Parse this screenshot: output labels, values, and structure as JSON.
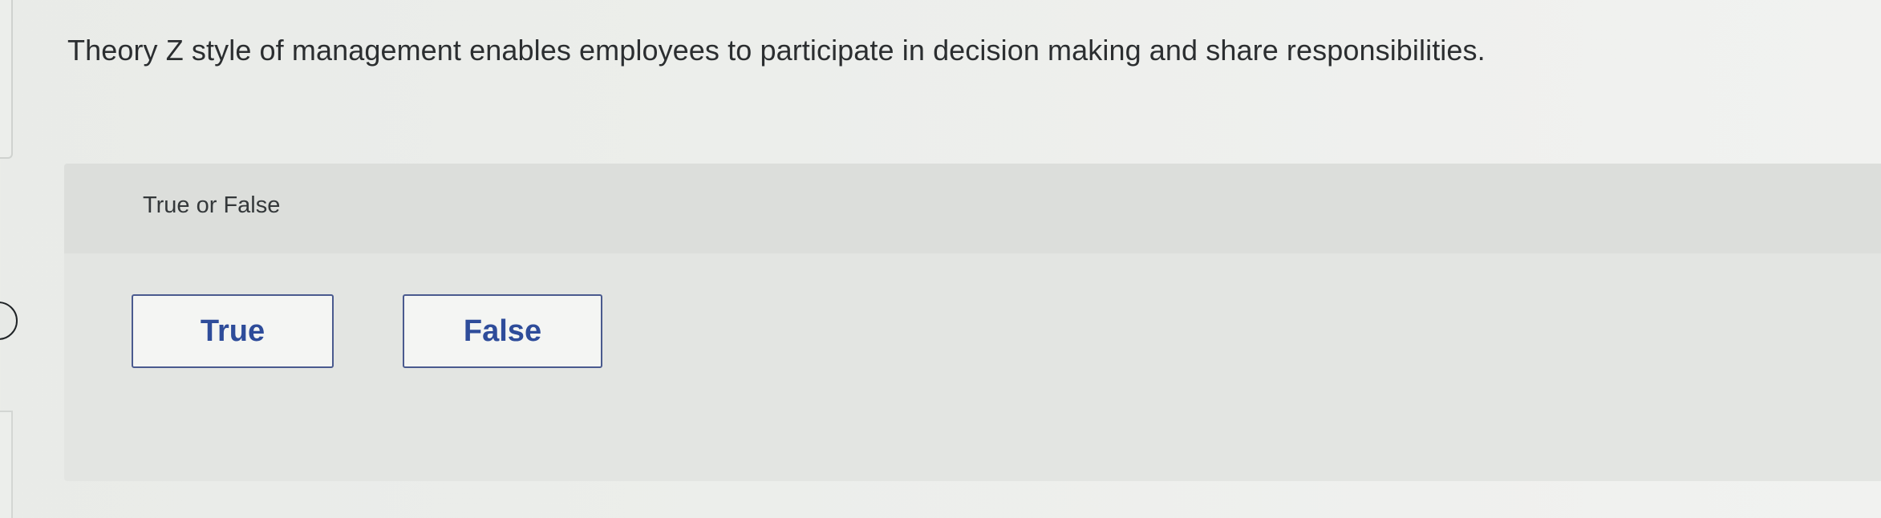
{
  "question": {
    "text": "Theory Z style of management enables employees to participate in decision making and share responsibilities."
  },
  "answer_area": {
    "prompt_label": "True or False",
    "choices": [
      {
        "label": "True"
      },
      {
        "label": "False"
      }
    ]
  },
  "colors": {
    "choice_text": "#2e4c9a",
    "choice_border": "#4a5a8e",
    "panel_background": "#e3e5e2"
  }
}
